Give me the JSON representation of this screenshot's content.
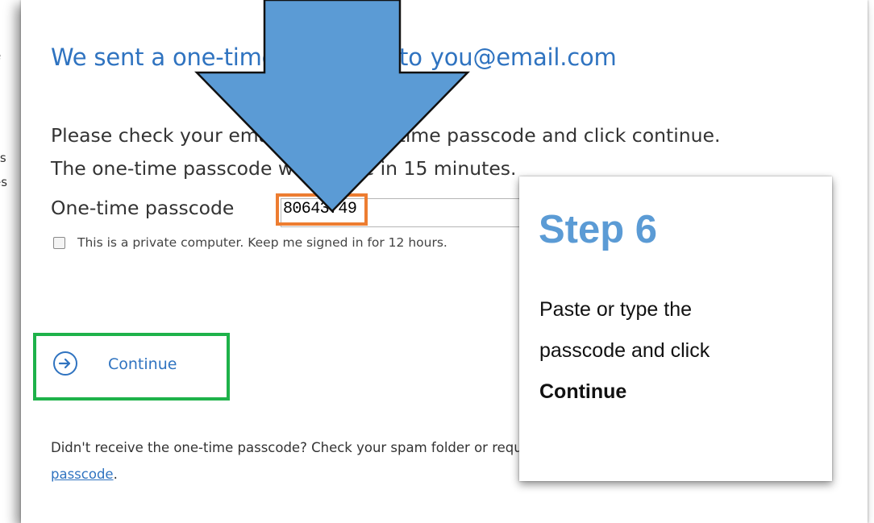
{
  "background": {
    "fragments": [
      "e",
      "ss",
      "es"
    ]
  },
  "dialog": {
    "title_prefix": "We sent a one-time passcode to",
    "title_email": "you@email.com",
    "instructions_line1": "Please check your email for the one-time passcode and click continue.",
    "instructions_line2": "The one-time passcode will expire in 15 minutes.",
    "code_label": "One-time passcode",
    "code_value": "80643749",
    "remember_label": "This is a private computer. Keep me signed in for 12 hours.",
    "continue_label": "Continue",
    "footer_line1": "Didn't receive the one-time passcode? Check your spam folder or request a new",
    "footer_link": "passcode",
    "footer_end": "."
  },
  "callout": {
    "title": "Step 6",
    "body_line1": "Paste or type the",
    "body_line2": "passcode and click",
    "body_bold": "Continue"
  },
  "colors": {
    "accent_blue": "#2f73c0",
    "arrow_blue": "#5b9bd5",
    "highlight_orange": "#ed7d31",
    "highlight_green": "#1eb24a"
  }
}
